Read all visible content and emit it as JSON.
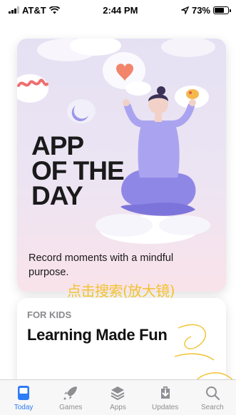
{
  "status_bar": {
    "carrier": "AT&T",
    "time": "2:44 PM",
    "battery_percent": "73%",
    "battery_level": 0.73
  },
  "feature_card": {
    "title_lines": [
      "APP",
      "OF THE",
      "DAY"
    ],
    "caption": "Record moments with a mindful purpose."
  },
  "kids_card": {
    "label": "FOR KIDS",
    "title": "Learning Made Fun"
  },
  "annotation": {
    "text": "点击搜索(放大镜)",
    "color": "#f2c230"
  },
  "tab_bar": {
    "active_color": "#2f7cf6",
    "tabs": [
      {
        "label": "Today",
        "icon": "today-icon",
        "active": true
      },
      {
        "label": "Games",
        "icon": "rocket-icon",
        "active": false
      },
      {
        "label": "Apps",
        "icon": "layers-icon",
        "active": false
      },
      {
        "label": "Updates",
        "icon": "download-icon",
        "active": false
      },
      {
        "label": "Search",
        "icon": "search-icon",
        "active": false
      }
    ]
  }
}
